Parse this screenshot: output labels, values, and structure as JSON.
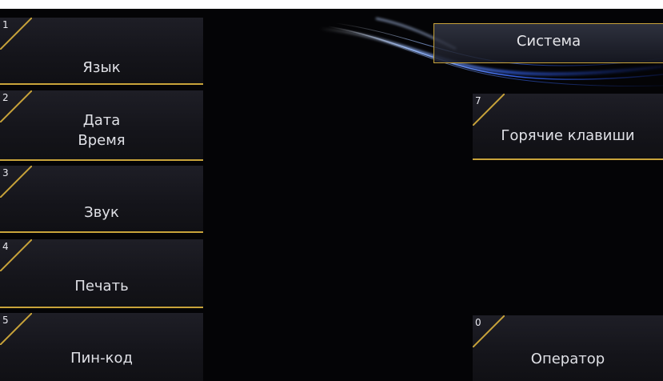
{
  "header": {
    "title": "Система"
  },
  "left_menu": [
    {
      "num": "1",
      "line1": "Язык",
      "line2": ""
    },
    {
      "num": "2",
      "line1": "Дата",
      "line2": "Время"
    },
    {
      "num": "3",
      "line1": "Звук",
      "line2": ""
    },
    {
      "num": "4",
      "line1": "Печать",
      "line2": ""
    },
    {
      "num": "5",
      "line1": "Пин-код",
      "line2": ""
    }
  ],
  "right_menu": [
    {
      "num": "7",
      "label": "Горячие клавиши"
    },
    {
      "num": "0",
      "label": "Оператор"
    }
  ],
  "colors": {
    "accent": "#c8a33a",
    "background": "#040406",
    "tile": "#18181e",
    "glow": "#3a6cff"
  }
}
